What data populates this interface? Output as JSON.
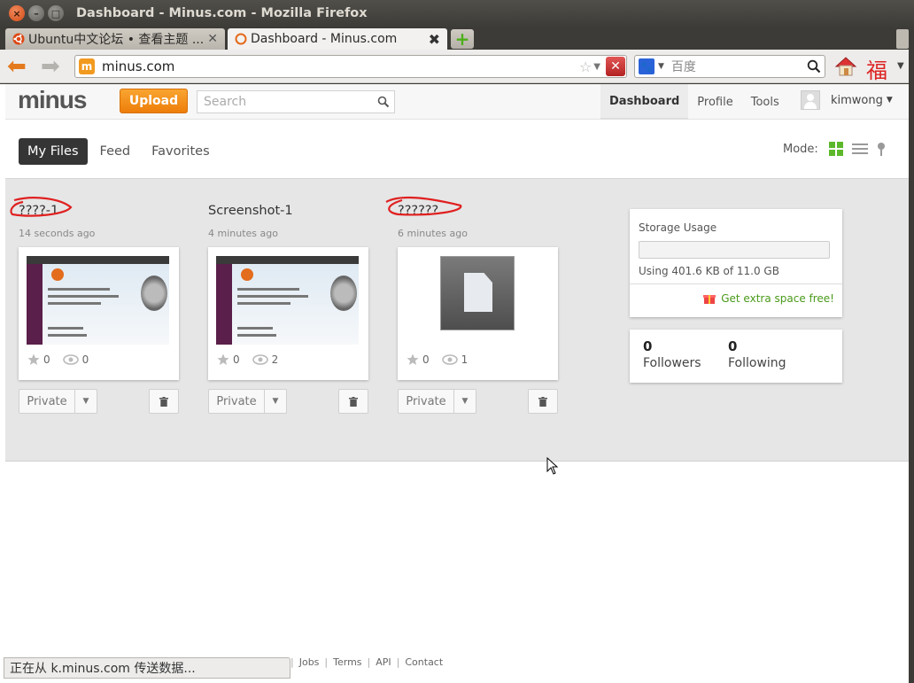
{
  "window": {
    "title": "Dashboard - Minus.com - Mozilla Firefox"
  },
  "browser": {
    "tabs": [
      {
        "label": "Ubuntu中文论坛 • 查看主题 ...",
        "active": false
      },
      {
        "label": "Dashboard - Minus.com",
        "active": true
      }
    ],
    "url": "minus.com",
    "search_placeholder": "百度",
    "status": "正在从 k.minus.com 传送数据...",
    "fu_glyph": "福"
  },
  "site": {
    "logo": "minus",
    "upload_label": "Upload",
    "search_placeholder": "Search",
    "nav": [
      {
        "label": "Dashboard",
        "active": true
      },
      {
        "label": "Profile",
        "active": false
      },
      {
        "label": "Tools",
        "active": false
      }
    ],
    "username": "kimwong",
    "tabs": [
      {
        "label": "My Files",
        "active": true
      },
      {
        "label": "Feed",
        "active": false
      },
      {
        "label": "Favorites",
        "active": false
      }
    ],
    "mode_label": "Mode:"
  },
  "files": [
    {
      "name": "????-1",
      "time": "14 seconds ago",
      "stars": "0",
      "views": "0",
      "privacy": "Private"
    },
    {
      "name": "Screenshot-1",
      "time": "4 minutes ago",
      "stars": "0",
      "views": "2",
      "privacy": "Private"
    },
    {
      "name": "??????",
      "time": "6 minutes ago",
      "stars": "0",
      "views": "1",
      "privacy": "Private"
    }
  ],
  "storage": {
    "title": "Storage Usage",
    "usage_text": "Using 401.6 KB of 11.0 GB",
    "used_fraction": 3.57e-05,
    "extra_label": "Get extra space free!"
  },
  "social": {
    "followers_count": "0",
    "followers_label": "Followers",
    "following_count": "0",
    "following_label": "Following"
  },
  "footer": {
    "links": [
      "Jobs",
      "Terms",
      "API",
      "Contact"
    ]
  },
  "colors": {
    "accent": "#ee7e0a",
    "extra_link": "#4a9a1a",
    "mode_active": "#5cb82a",
    "scribble": "#e02020"
  }
}
